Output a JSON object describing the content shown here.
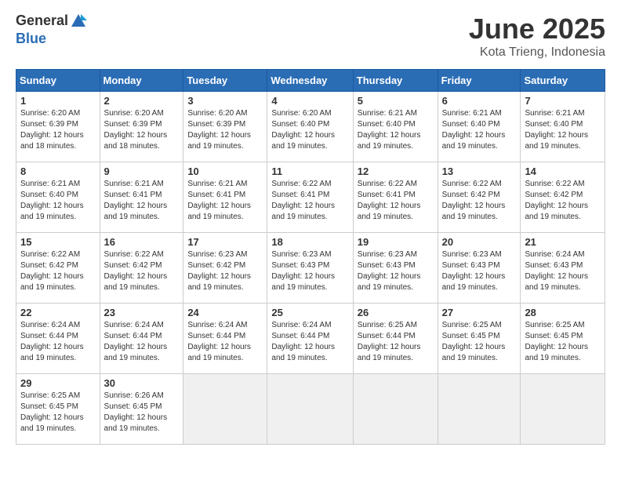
{
  "header": {
    "logo_general": "General",
    "logo_blue": "Blue",
    "title": "June 2025",
    "location": "Kota Trieng, Indonesia"
  },
  "weekdays": [
    "Sunday",
    "Monday",
    "Tuesday",
    "Wednesday",
    "Thursday",
    "Friday",
    "Saturday"
  ],
  "weeks": [
    [
      {
        "day": "1",
        "info": "Sunrise: 6:20 AM\nSunset: 6:39 PM\nDaylight: 12 hours\nand 18 minutes."
      },
      {
        "day": "2",
        "info": "Sunrise: 6:20 AM\nSunset: 6:39 PM\nDaylight: 12 hours\nand 18 minutes."
      },
      {
        "day": "3",
        "info": "Sunrise: 6:20 AM\nSunset: 6:39 PM\nDaylight: 12 hours\nand 19 minutes."
      },
      {
        "day": "4",
        "info": "Sunrise: 6:20 AM\nSunset: 6:40 PM\nDaylight: 12 hours\nand 19 minutes."
      },
      {
        "day": "5",
        "info": "Sunrise: 6:21 AM\nSunset: 6:40 PM\nDaylight: 12 hours\nand 19 minutes."
      },
      {
        "day": "6",
        "info": "Sunrise: 6:21 AM\nSunset: 6:40 PM\nDaylight: 12 hours\nand 19 minutes."
      },
      {
        "day": "7",
        "info": "Sunrise: 6:21 AM\nSunset: 6:40 PM\nDaylight: 12 hours\nand 19 minutes."
      }
    ],
    [
      {
        "day": "8",
        "info": "Sunrise: 6:21 AM\nSunset: 6:40 PM\nDaylight: 12 hours\nand 19 minutes."
      },
      {
        "day": "9",
        "info": "Sunrise: 6:21 AM\nSunset: 6:41 PM\nDaylight: 12 hours\nand 19 minutes."
      },
      {
        "day": "10",
        "info": "Sunrise: 6:21 AM\nSunset: 6:41 PM\nDaylight: 12 hours\nand 19 minutes."
      },
      {
        "day": "11",
        "info": "Sunrise: 6:22 AM\nSunset: 6:41 PM\nDaylight: 12 hours\nand 19 minutes."
      },
      {
        "day": "12",
        "info": "Sunrise: 6:22 AM\nSunset: 6:41 PM\nDaylight: 12 hours\nand 19 minutes."
      },
      {
        "day": "13",
        "info": "Sunrise: 6:22 AM\nSunset: 6:42 PM\nDaylight: 12 hours\nand 19 minutes."
      },
      {
        "day": "14",
        "info": "Sunrise: 6:22 AM\nSunset: 6:42 PM\nDaylight: 12 hours\nand 19 minutes."
      }
    ],
    [
      {
        "day": "15",
        "info": "Sunrise: 6:22 AM\nSunset: 6:42 PM\nDaylight: 12 hours\nand 19 minutes."
      },
      {
        "day": "16",
        "info": "Sunrise: 6:22 AM\nSunset: 6:42 PM\nDaylight: 12 hours\nand 19 minutes."
      },
      {
        "day": "17",
        "info": "Sunrise: 6:23 AM\nSunset: 6:42 PM\nDaylight: 12 hours\nand 19 minutes."
      },
      {
        "day": "18",
        "info": "Sunrise: 6:23 AM\nSunset: 6:43 PM\nDaylight: 12 hours\nand 19 minutes."
      },
      {
        "day": "19",
        "info": "Sunrise: 6:23 AM\nSunset: 6:43 PM\nDaylight: 12 hours\nand 19 minutes."
      },
      {
        "day": "20",
        "info": "Sunrise: 6:23 AM\nSunset: 6:43 PM\nDaylight: 12 hours\nand 19 minutes."
      },
      {
        "day": "21",
        "info": "Sunrise: 6:24 AM\nSunset: 6:43 PM\nDaylight: 12 hours\nand 19 minutes."
      }
    ],
    [
      {
        "day": "22",
        "info": "Sunrise: 6:24 AM\nSunset: 6:44 PM\nDaylight: 12 hours\nand 19 minutes."
      },
      {
        "day": "23",
        "info": "Sunrise: 6:24 AM\nSunset: 6:44 PM\nDaylight: 12 hours\nand 19 minutes."
      },
      {
        "day": "24",
        "info": "Sunrise: 6:24 AM\nSunset: 6:44 PM\nDaylight: 12 hours\nand 19 minutes."
      },
      {
        "day": "25",
        "info": "Sunrise: 6:24 AM\nSunset: 6:44 PM\nDaylight: 12 hours\nand 19 minutes."
      },
      {
        "day": "26",
        "info": "Sunrise: 6:25 AM\nSunset: 6:44 PM\nDaylight: 12 hours\nand 19 minutes."
      },
      {
        "day": "27",
        "info": "Sunrise: 6:25 AM\nSunset: 6:45 PM\nDaylight: 12 hours\nand 19 minutes."
      },
      {
        "day": "28",
        "info": "Sunrise: 6:25 AM\nSunset: 6:45 PM\nDaylight: 12 hours\nand 19 minutes."
      }
    ],
    [
      {
        "day": "29",
        "info": "Sunrise: 6:25 AM\nSunset: 6:45 PM\nDaylight: 12 hours\nand 19 minutes."
      },
      {
        "day": "30",
        "info": "Sunrise: 6:26 AM\nSunset: 6:45 PM\nDaylight: 12 hours\nand 19 minutes."
      },
      {
        "day": "",
        "info": ""
      },
      {
        "day": "",
        "info": ""
      },
      {
        "day": "",
        "info": ""
      },
      {
        "day": "",
        "info": ""
      },
      {
        "day": "",
        "info": ""
      }
    ]
  ]
}
